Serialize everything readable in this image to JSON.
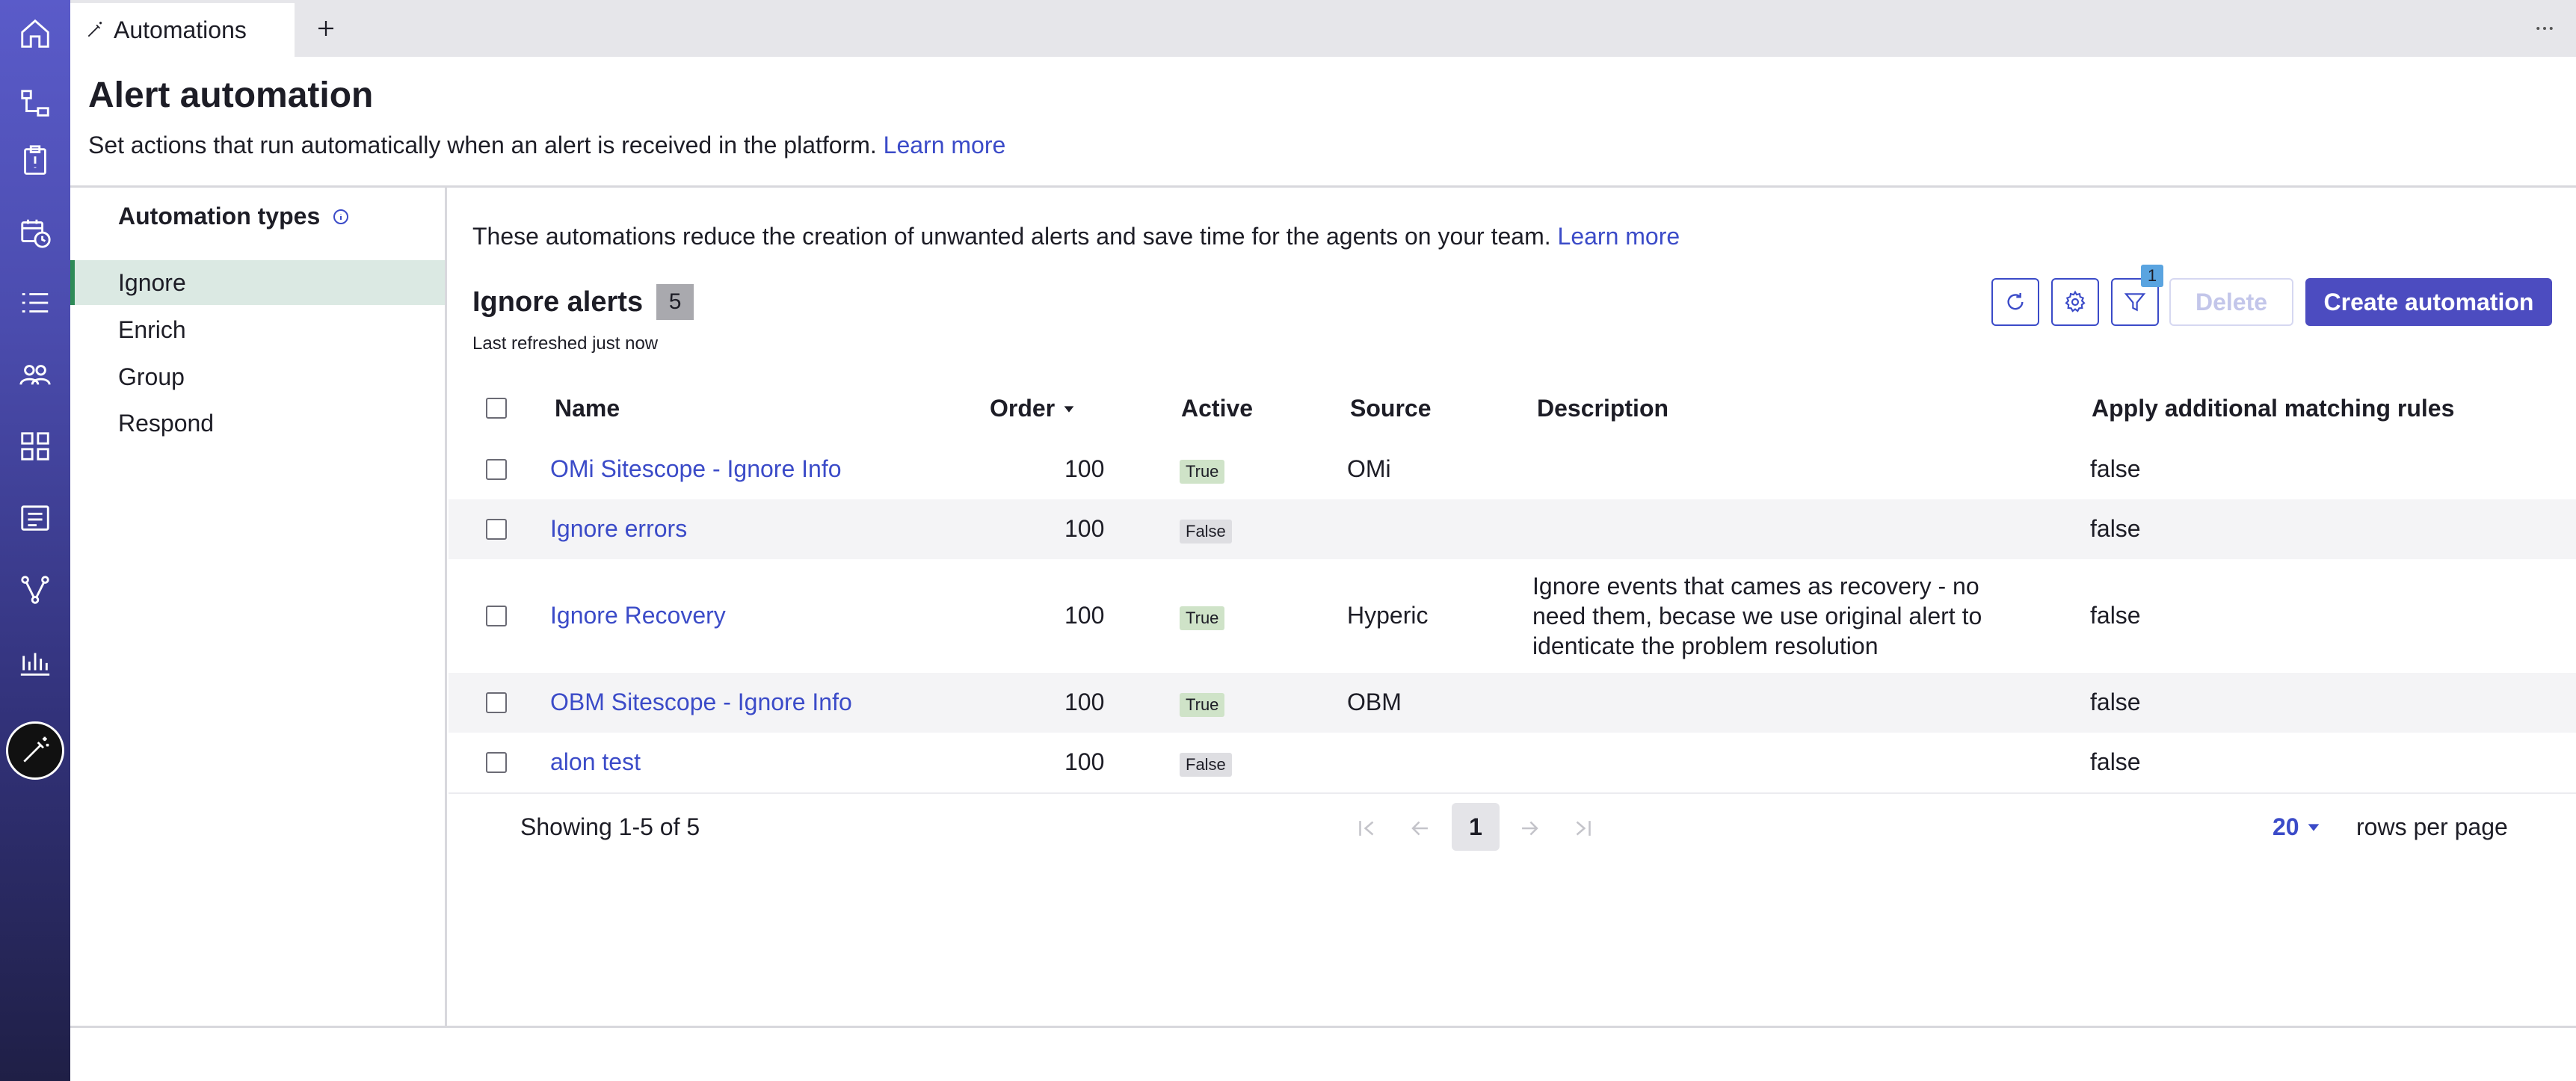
{
  "tab": {
    "label": "Automations"
  },
  "page": {
    "title": "Alert automation",
    "subtitle": "Set actions that run automatically when an alert is received in the platform.",
    "learn_more": "Learn more"
  },
  "sidebar": {
    "title": "Automation types",
    "items": [
      {
        "label": "Ignore",
        "active": true
      },
      {
        "label": "Enrich",
        "active": false
      },
      {
        "label": "Group",
        "active": false
      },
      {
        "label": "Respond",
        "active": false
      }
    ]
  },
  "main": {
    "info_text": "These automations reduce the creation of unwanted alerts and save time for the agents on your team.",
    "info_learn_more": "Learn more",
    "section_title": "Ignore alerts",
    "count": "5",
    "last_refreshed": "Last refreshed just now",
    "filter_count": "1",
    "delete_label": "Delete",
    "create_label": "Create automation"
  },
  "table": {
    "columns": {
      "name": "Name",
      "order": "Order",
      "active": "Active",
      "source": "Source",
      "description": "Description",
      "rules": "Apply additional matching rules"
    },
    "rows": [
      {
        "name": "OMi Sitescope - Ignore Info",
        "order": "100",
        "active": "True",
        "source": "OMi",
        "description": "",
        "rules": "false"
      },
      {
        "name": "Ignore errors",
        "order": "100",
        "active": "False",
        "source": "",
        "description": "",
        "rules": "false"
      },
      {
        "name": "Ignore Recovery",
        "order": "100",
        "active": "True",
        "source": "Hyperic",
        "description_lines": [
          "Ignore events that cames as recovery - no",
          "need them, becase we use original alert to",
          "identicate the problem resolution"
        ],
        "rules": "false"
      },
      {
        "name": "OBM Sitescope - Ignore Info",
        "order": "100",
        "active": "True",
        "source": "OBM",
        "description": "",
        "rules": "false"
      },
      {
        "name": "alon test",
        "order": "100",
        "active": "False",
        "source": "",
        "description": "",
        "rules": "false"
      }
    ]
  },
  "pagination": {
    "showing": "Showing 1-5 of 5",
    "current_page": "1",
    "rows_per_page_value": "20",
    "rows_per_page_label": "rows per page"
  },
  "colors": {
    "accent": "#4c4cc0",
    "link": "#3b4bc8",
    "active_nav": "#dbe9e3",
    "true_badge": "#cfe3c8",
    "false_badge": "#dedee2"
  }
}
